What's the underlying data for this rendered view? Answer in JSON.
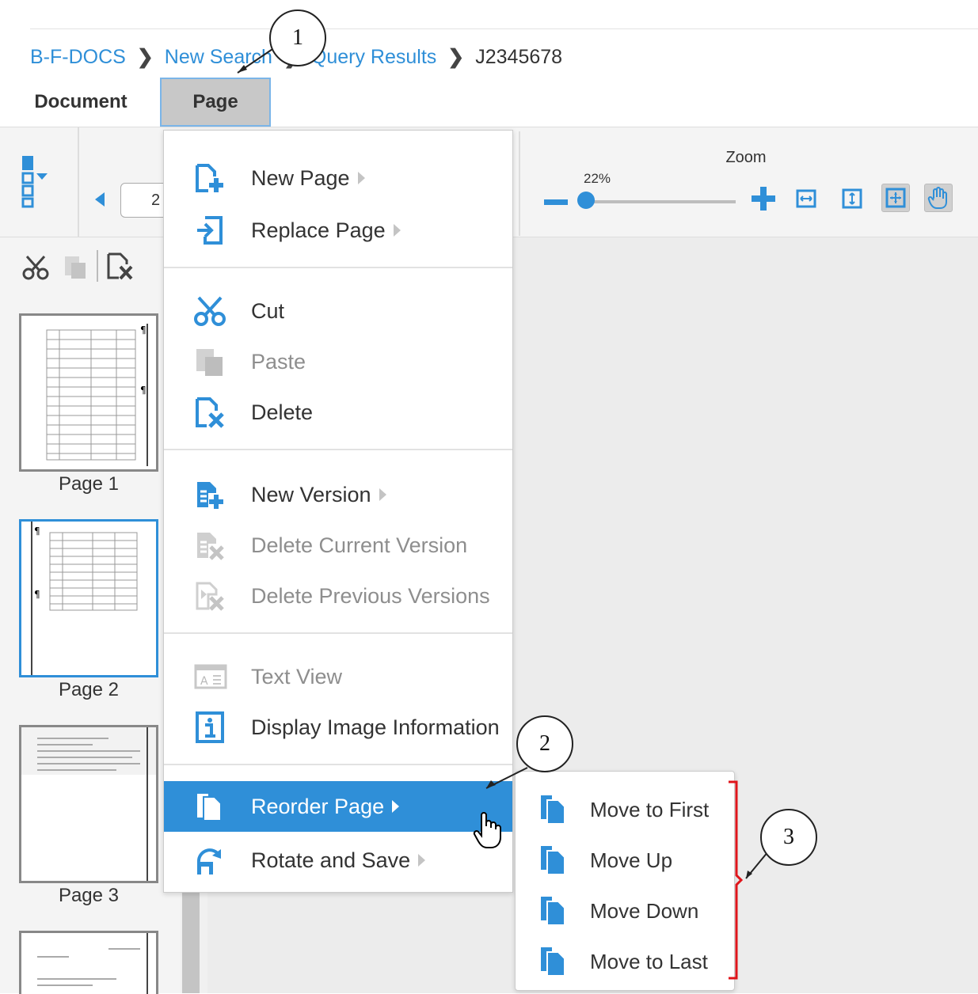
{
  "breadcrumb": {
    "items": [
      "B-F-DOCS",
      "New Search",
      "Query Results"
    ],
    "current": "J2345678"
  },
  "tabs": {
    "document": "Document",
    "page": "Page"
  },
  "toolbar": {
    "page_input_value": "2",
    "zoom_label": "Zoom",
    "zoom_percent": "22%",
    "zoom_level": 0.22
  },
  "thumbnails": [
    {
      "label": "Page 1",
      "selected": false
    },
    {
      "label": "Page 2",
      "selected": true
    },
    {
      "label": "Page 3",
      "selected": false
    }
  ],
  "menu": {
    "items": [
      {
        "label": "New Page",
        "icon": "new-page-icon",
        "submenu": true,
        "disabled": false
      },
      {
        "label": "Replace Page",
        "icon": "replace-page-icon",
        "submenu": true,
        "disabled": false
      },
      {
        "label": "Cut",
        "icon": "scissors-icon",
        "submenu": false,
        "disabled": false
      },
      {
        "label": "Paste",
        "icon": "paste-icon",
        "submenu": false,
        "disabled": true
      },
      {
        "label": "Delete",
        "icon": "delete-page-icon",
        "submenu": false,
        "disabled": false
      },
      {
        "label": "New Version",
        "icon": "new-version-icon",
        "submenu": true,
        "disabled": false
      },
      {
        "label": "Delete Current Version",
        "icon": "delete-current-version-icon",
        "submenu": false,
        "disabled": true
      },
      {
        "label": "Delete Previous Versions",
        "icon": "delete-previous-versions-icon",
        "submenu": false,
        "disabled": true
      },
      {
        "label": "Text View",
        "icon": "text-view-icon",
        "submenu": false,
        "disabled": true
      },
      {
        "label": "Display Image Information",
        "icon": "info-icon",
        "submenu": false,
        "disabled": false
      },
      {
        "label": "Reorder Page",
        "icon": "reorder-page-icon",
        "submenu": true,
        "disabled": false,
        "highlighted": true
      },
      {
        "label": "Rotate and Save",
        "icon": "rotate-save-icon",
        "submenu": true,
        "disabled": false
      }
    ]
  },
  "submenu": {
    "items": [
      "Move to First",
      "Move Up",
      "Move Down",
      "Move to Last"
    ]
  },
  "callouts": [
    "1",
    "2",
    "3"
  ],
  "colors": {
    "accent": "#2f8fd8",
    "bracket": "#e0151b",
    "disabled_text": "#8e8e8e",
    "active_tab_bg": "#c8c8c8"
  }
}
